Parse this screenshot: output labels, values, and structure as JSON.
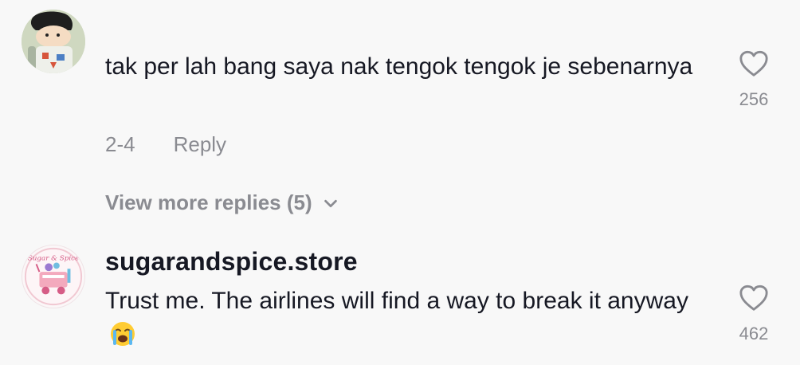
{
  "comments": [
    {
      "username": "",
      "text": "tak per lah bang saya nak tengok tengok je sebenarnya",
      "date": "2-4",
      "reply_label": "Reply",
      "likes": "256",
      "view_more_label": "View more replies (5)"
    },
    {
      "username": "sugarandspice.store",
      "text": "Trust me. The airlines will find a way to break it anyway",
      "emoji": "loudly-crying-face-emoji",
      "likes": "462",
      "avatar_text": "Sugar & Spice"
    }
  ],
  "colors": {
    "text": "#161823",
    "muted": "#8a8b91",
    "background": "#f8f8f8"
  },
  "icons": {
    "like": "heart-outline-icon",
    "expand": "chevron-down-icon"
  }
}
